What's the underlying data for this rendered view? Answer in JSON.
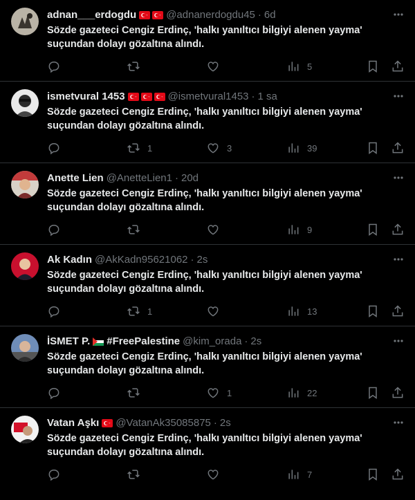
{
  "colors": {
    "background": "#000000",
    "divider": "#2f3336",
    "text": "#e7e9ea",
    "muted": "#71767b"
  },
  "icons": {
    "reply": "reply-icon",
    "retweet": "retweet-icon",
    "like": "heart-icon",
    "views": "views-icon",
    "bookmark": "bookmark-icon",
    "share": "share-icon",
    "more": "more-icon"
  },
  "tweets": [
    {
      "name": "adnan___erdogdu",
      "flags": [
        "tr",
        "tr"
      ],
      "handle": "@adnanerdogdu45",
      "sep": "·",
      "time": "6d",
      "text": "Sözde gazeteci Cengiz Erdinç, 'halkı yanıltıcı bilgiyi alenen yayma' suçundan dolayı gözaltına alındı.",
      "replies": "",
      "retweets": "",
      "likes": "",
      "views": "5"
    },
    {
      "name": "ismetvural 1453",
      "flags": [
        "tr",
        "tr",
        "tr"
      ],
      "handle": "@ismetvural1453",
      "sep": "·",
      "time": "1 sa",
      "text": "Sözde gazeteci Cengiz Erdinç, 'halkı yanıltıcı bilgiyi alenen yayma' suçundan dolayı gözaltına alındı.",
      "replies": "",
      "retweets": "1",
      "likes": "3",
      "views": "39"
    },
    {
      "name": "Anette Lien",
      "flags": [],
      "handle": "@AnetteLien1",
      "sep": "·",
      "time": "20d",
      "text": "Sözde gazeteci Cengiz Erdinç, 'halkı yanıltıcı bilgiyi alenen yayma' suçundan dolayı gözaltına alındı.",
      "replies": "",
      "retweets": "",
      "likes": "",
      "views": "9"
    },
    {
      "name": "Ak Kadın",
      "flags": [],
      "handle": "@AkKadn95621062",
      "sep": "·",
      "time": "2s",
      "text": "Sözde gazeteci Cengiz Erdinç, 'halkı yanıltıcı bilgiyi alenen yayma' suçundan dolayı gözaltına alındı.",
      "replies": "",
      "retweets": "1",
      "likes": "",
      "views": "13"
    },
    {
      "name": "İSMET P.",
      "flags": [
        "ps"
      ],
      "name_suffix": "#FreePalestine",
      "handle": "@kim_orada",
      "sep": "·",
      "time": "2s",
      "text": "Sözde gazeteci Cengiz Erdinç, 'halkı yanıltıcı bilgiyi alenen yayma' suçundan dolayı gözaltına alındı.",
      "replies": "",
      "retweets": "",
      "likes": "1",
      "views": "22"
    },
    {
      "name": "Vatan Aşkı",
      "flags": [
        "tr"
      ],
      "handle": "@VatanAk35085875",
      "sep": "·",
      "time": "2s",
      "text": "Sözde gazeteci Cengiz Erdinç, 'halkı yanıltıcı bilgiyi alenen yayma' suçundan dolayı gözaltına alındı.",
      "replies": "",
      "retweets": "",
      "likes": "",
      "views": "7"
    }
  ]
}
